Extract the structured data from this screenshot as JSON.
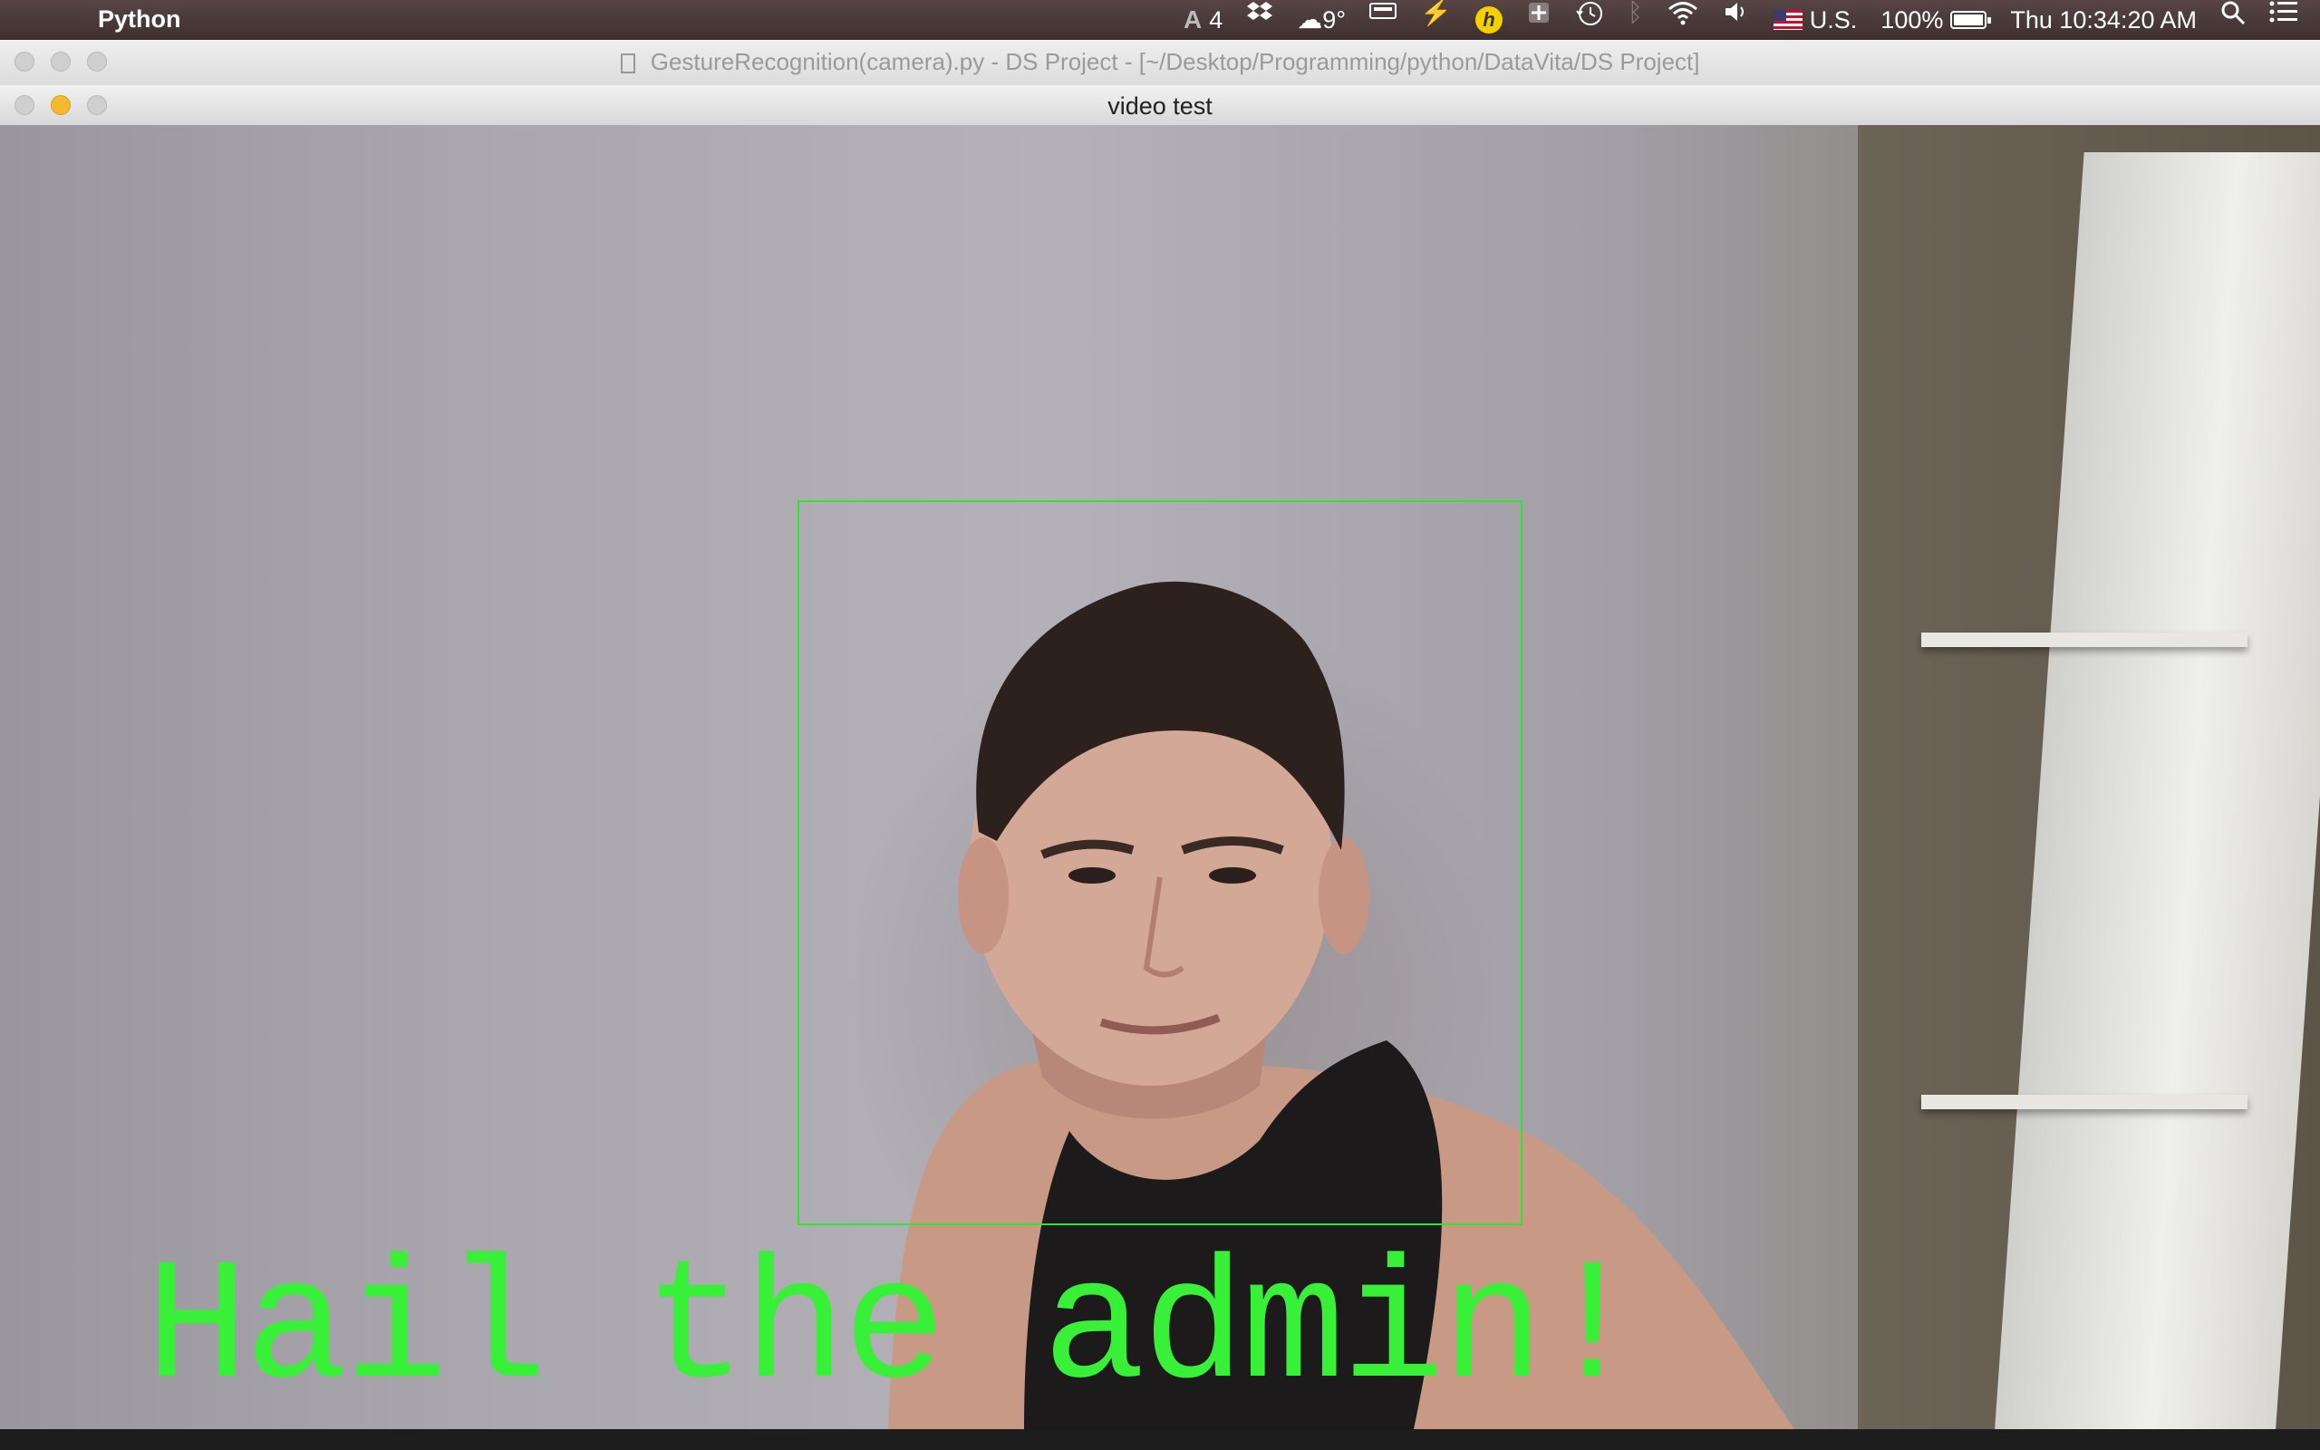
{
  "menubar": {
    "app_name": "Python",
    "adobe_count": "4",
    "weather": "9°",
    "input_source": "U.S.",
    "battery": "100%",
    "clock": "Thu 10:34:20 AM"
  },
  "editor_window": {
    "title": "GestureRecognition(camera).py - DS Project - [~/Desktop/Programming/python/DataVita/DS Project]"
  },
  "video_window": {
    "title": "video test",
    "overlay_text": "Hail the admin!",
    "overlay_color": "#38f038",
    "face_box_color": "#2fe62f"
  }
}
